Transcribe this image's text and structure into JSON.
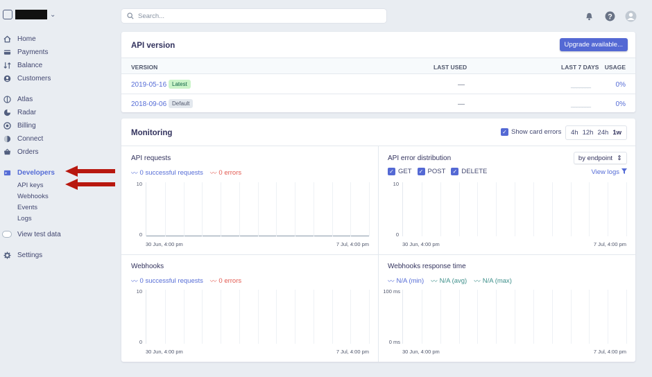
{
  "account": {
    "name_redacted": true
  },
  "sidebar": {
    "items": [
      {
        "label": "Home",
        "icon": "home-icon"
      },
      {
        "label": "Payments",
        "icon": "payments-icon"
      },
      {
        "label": "Balance",
        "icon": "balance-icon"
      },
      {
        "label": "Customers",
        "icon": "customers-icon"
      },
      {
        "label": "Atlas",
        "icon": "atlas-icon"
      },
      {
        "label": "Radar",
        "icon": "radar-icon"
      },
      {
        "label": "Billing",
        "icon": "billing-icon"
      },
      {
        "label": "Connect",
        "icon": "connect-icon"
      },
      {
        "label": "Orders",
        "icon": "orders-icon"
      },
      {
        "label": "Developers",
        "icon": "developers-icon",
        "active": true
      }
    ],
    "developer_subitems": [
      "API keys",
      "Webhooks",
      "Events",
      "Logs"
    ],
    "view_test_data": "View test data",
    "settings": "Settings"
  },
  "search": {
    "placeholder": "Search..."
  },
  "api_version": {
    "title": "API version",
    "upgrade_button": "Upgrade available...",
    "columns": [
      "VERSION",
      "LAST USED",
      "LAST 7 DAYS",
      "USAGE"
    ],
    "rows": [
      {
        "version": "2019-05-16",
        "badge": "Latest",
        "last_used": "—",
        "last_7_days": "_______",
        "usage": "0%"
      },
      {
        "version": "2018-09-06",
        "badge": "Default",
        "last_used": "—",
        "last_7_days": "_______",
        "usage": "0%"
      }
    ]
  },
  "monitoring": {
    "title": "Monitoring",
    "show_card_errors": "Show card errors",
    "ranges": [
      "4h",
      "12h",
      "24h",
      "1w"
    ],
    "selected_range": "1w",
    "panels": {
      "api_requests": {
        "title": "API requests",
        "legend": [
          "0 successful requests",
          "0 errors"
        ],
        "y_top": "10",
        "y_bottom": "0",
        "x_start": "30 Jun, 4:00 pm",
        "x_end": "7 Jul, 4:00 pm"
      },
      "api_errors": {
        "title": "API error distribution",
        "select": "by endpoint",
        "checkboxes": [
          "GET",
          "POST",
          "DELETE"
        ],
        "view_logs": "View logs",
        "y_top": "10",
        "y_bottom": "0",
        "x_start": "30 Jun, 4:00 pm",
        "x_end": "7 Jul, 4:00 pm"
      },
      "webhooks": {
        "title": "Webhooks",
        "legend": [
          "0 successful requests",
          "0 errors"
        ],
        "y_top": "10",
        "y_bottom": "0",
        "x_start": "30 Jun, 4:00 pm",
        "x_end": "7 Jul, 4:00 pm"
      },
      "webhooks_response": {
        "title": "Webhooks response time",
        "legend": [
          "N/A (min)",
          "N/A (avg)",
          "N/A (max)"
        ],
        "y_top": "100 ms",
        "y_bottom": "0 ms",
        "x_start": "30 Jun, 4:00 pm",
        "x_end": "7 Jul, 4:00 pm"
      }
    }
  },
  "colors": {
    "accent": "#556cd6",
    "button": "#5469d4",
    "error": "#e25950",
    "annotation_arrow": "#b8180f"
  }
}
